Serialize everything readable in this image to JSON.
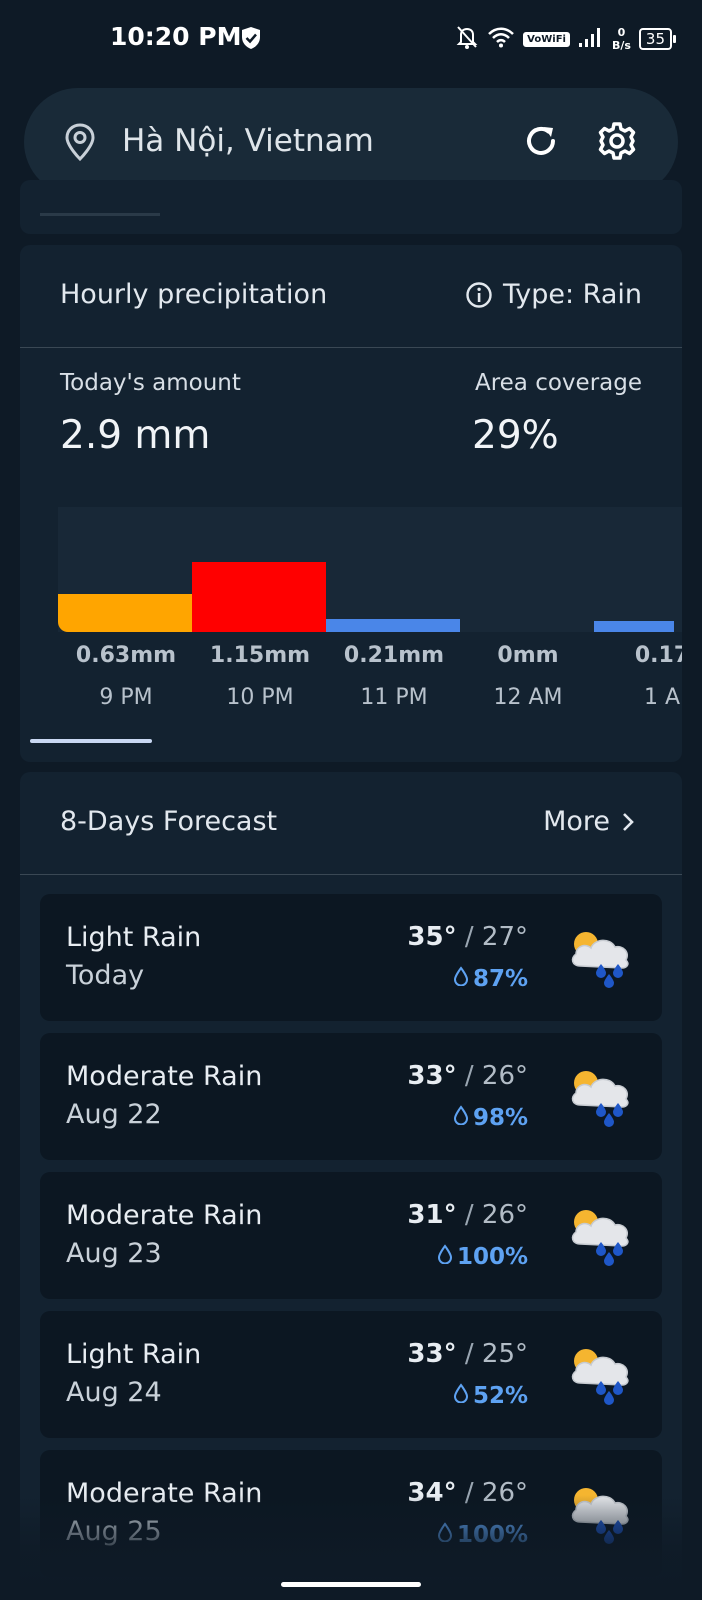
{
  "status_bar": {
    "time": "10:20 PM",
    "network_label": "VoWiFi",
    "speed_value": "0",
    "speed_unit": "B/s",
    "battery": "35"
  },
  "search": {
    "location": "Hà Nội, Vietnam",
    "icons": [
      "location-pin-icon",
      "refresh-icon",
      "gear-icon"
    ]
  },
  "precipitation": {
    "title": "Hourly precipitation",
    "type_label": "Type: Rain",
    "today_label": "Today's amount",
    "today_value": "2.9 mm",
    "coverage_label": "Area coverage",
    "coverage_value": "29%",
    "bars": [
      {
        "value_label": "0.63mm",
        "time": "9 PM",
        "amount": 0.63,
        "color": "#ffa500"
      },
      {
        "value_label": "1.15mm",
        "time": "10 PM",
        "amount": 1.15,
        "color": "#ff0000"
      },
      {
        "value_label": "0.21mm",
        "time": "11 PM",
        "amount": 0.21,
        "color": "#4a86e8"
      },
      {
        "value_label": "0mm",
        "time": "12 AM",
        "amount": 0,
        "color": "#4a86e8"
      },
      {
        "value_label": "0.17",
        "time": "1 A",
        "amount": 0.17,
        "color": "#4a86e8"
      }
    ]
  },
  "forecast": {
    "title": "8-Days Forecast",
    "more_label": "More",
    "days": [
      {
        "condition": "Light Rain",
        "date": "Today",
        "high": "35°",
        "low": "27°",
        "humidity": "87%"
      },
      {
        "condition": "Moderate Rain",
        "date": "Aug 22",
        "high": "33°",
        "low": "26°",
        "humidity": "98%"
      },
      {
        "condition": "Moderate Rain",
        "date": "Aug 23",
        "high": "31°",
        "low": "26°",
        "humidity": "100%"
      },
      {
        "condition": "Light Rain",
        "date": "Aug 24",
        "high": "33°",
        "low": "25°",
        "humidity": "52%"
      },
      {
        "condition": "Moderate Rain",
        "date": "Aug 25",
        "high": "34°",
        "low": "26°",
        "humidity": "100%"
      }
    ]
  },
  "colors": {
    "background": "#0e1a26",
    "card": "#132230",
    "accent_blue": "#5ea2f2"
  }
}
